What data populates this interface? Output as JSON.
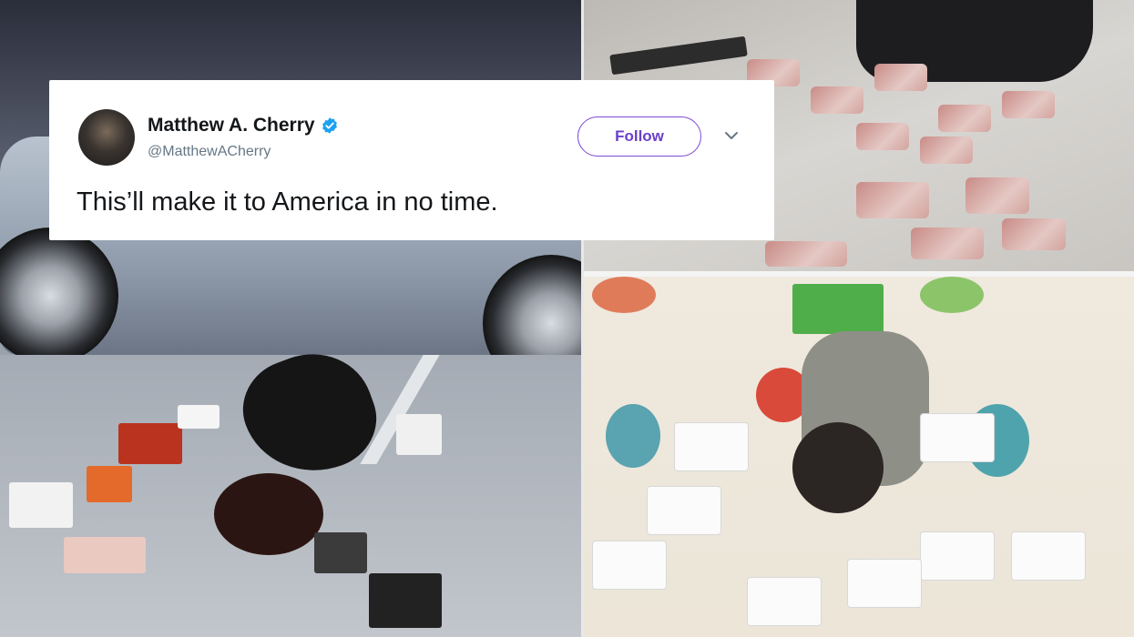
{
  "tweet": {
    "display_name": "Matthew A. Cherry",
    "handle": "@MatthewACherry",
    "verified": true,
    "follow_label": "Follow",
    "text": "This’ll make it to America in no time.",
    "avatar_icon": "avatar-photo",
    "menu_icon": "chevron-down-icon"
  },
  "colors": {
    "follow_accent": "#7b4bd6",
    "verified_blue": "#1da1f2",
    "text_primary": "#14171a",
    "text_secondary": "#657786"
  },
  "photos": [
    {
      "id": "car-floor-luxury",
      "description": "woman lying on garage floor beside silver sports car surrounded by luxury items"
    },
    {
      "id": "meat-floor",
      "description": "person lying on floor surrounded by packaged meat cuts"
    },
    {
      "id": "baby-diapers",
      "description": "baby lying on play mat surrounded by diapers"
    }
  ]
}
